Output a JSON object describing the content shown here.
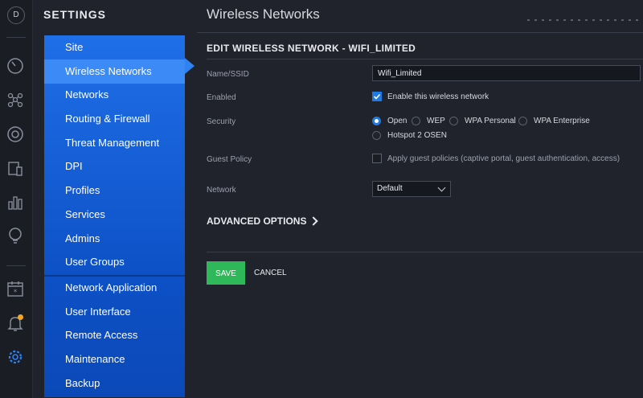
{
  "app": {
    "user_initial": "D"
  },
  "nav": {
    "title": "SETTINGS",
    "items": [
      {
        "label": "Site"
      },
      {
        "label": "Wireless Networks",
        "selected": true
      },
      {
        "label": "Networks"
      },
      {
        "label": "Routing & Firewall"
      },
      {
        "label": "Threat Management"
      },
      {
        "label": "DPI"
      },
      {
        "label": "Profiles"
      },
      {
        "label": "Services"
      },
      {
        "label": "Admins"
      },
      {
        "label": "User Groups"
      },
      {
        "label": "Network Application"
      },
      {
        "label": "User Interface"
      },
      {
        "label": "Remote Access"
      },
      {
        "label": "Maintenance"
      },
      {
        "label": "Backup"
      }
    ]
  },
  "rail_icons": [
    "speedometer-icon",
    "topology-icon",
    "target-icon",
    "devices-icon",
    "bar-chart-icon",
    "insights-icon",
    "calendar-icon",
    "bell-icon",
    "gear-icon"
  ],
  "page": {
    "title": "Wireless Networks"
  },
  "form": {
    "heading": "EDIT WIRELESS NETWORK - WIFI_LIMITED",
    "name_label": "Name/SSID",
    "name_value": "Wifi_Limited",
    "enabled_label": "Enabled",
    "enabled_text": "Enable this wireless network",
    "enabled_checked": true,
    "security_label": "Security",
    "security_options": [
      "Open",
      "WEP",
      "WPA Personal",
      "WPA Enterprise",
      "Hotspot 2 OSEN"
    ],
    "security_selected": "Open",
    "guest_label": "Guest Policy",
    "guest_text": "Apply guest policies (captive portal, guest authentication, access)",
    "guest_checked": false,
    "network_label": "Network",
    "network_value": "Default",
    "advanced_label": "ADVANCED OPTIONS",
    "save_label": "SAVE",
    "cancel_label": "CANCEL"
  },
  "colors": {
    "accent": "#1f7ae6",
    "nav_blue": "#1f6fe8",
    "save_green": "#2fb85a",
    "notification": "#f5a623"
  }
}
